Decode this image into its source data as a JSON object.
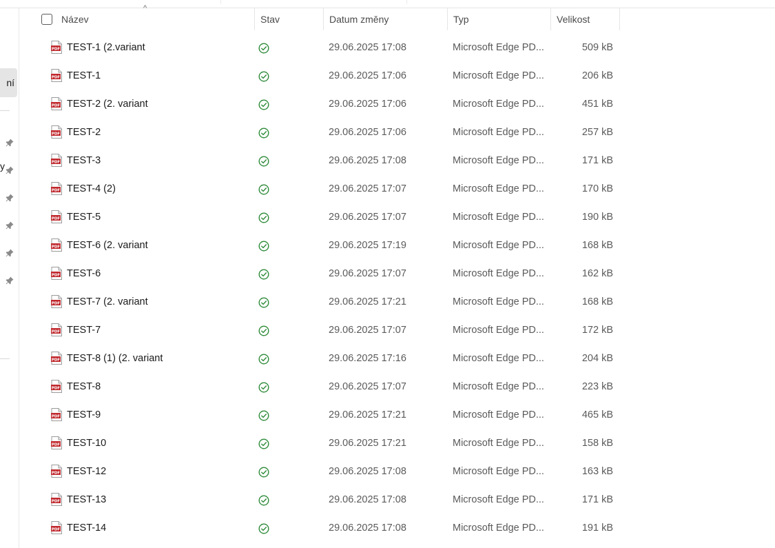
{
  "nav": {
    "active_label_fragment": "ní",
    "side_fragment": "y"
  },
  "columns": {
    "name": "Název",
    "status": "Stav",
    "date": "Datum změny",
    "type": "Typ",
    "size": "Velikost"
  },
  "files": [
    {
      "name": "TEST-1 (2.variant",
      "date": "29.06.2025 17:08",
      "type": "Microsoft Edge PD...",
      "size": "509 kB"
    },
    {
      "name": "TEST-1",
      "date": "29.06.2025 17:06",
      "type": "Microsoft Edge PD...",
      "size": "206 kB"
    },
    {
      "name": "TEST-2 (2. variant",
      "date": "29.06.2025 17:06",
      "type": "Microsoft Edge PD...",
      "size": "451 kB"
    },
    {
      "name": "TEST-2",
      "date": "29.06.2025 17:06",
      "type": "Microsoft Edge PD...",
      "size": "257 kB"
    },
    {
      "name": "TEST-3",
      "date": "29.06.2025 17:08",
      "type": "Microsoft Edge PD...",
      "size": "171 kB"
    },
    {
      "name": "TEST-4 (2)",
      "date": "29.06.2025 17:07",
      "type": "Microsoft Edge PD...",
      "size": "170 kB"
    },
    {
      "name": "TEST-5",
      "date": "29.06.2025 17:07",
      "type": "Microsoft Edge PD...",
      "size": "190 kB"
    },
    {
      "name": "TEST-6 (2. variant",
      "date": "29.06.2025 17:19",
      "type": "Microsoft Edge PD...",
      "size": "168 kB"
    },
    {
      "name": "TEST-6",
      "date": "29.06.2025 17:07",
      "type": "Microsoft Edge PD...",
      "size": "162 kB"
    },
    {
      "name": "TEST-7 (2. variant",
      "date": "29.06.2025 17:21",
      "type": "Microsoft Edge PD...",
      "size": "168 kB"
    },
    {
      "name": "TEST-7",
      "date": "29.06.2025 17:07",
      "type": "Microsoft Edge PD...",
      "size": "172 kB"
    },
    {
      "name": "TEST-8 (1) (2. variant",
      "date": "29.06.2025 17:16",
      "type": "Microsoft Edge PD...",
      "size": "204 kB"
    },
    {
      "name": "TEST-8",
      "date": "29.06.2025 17:07",
      "type": "Microsoft Edge PD...",
      "size": "223 kB"
    },
    {
      "name": "TEST-9",
      "date": "29.06.2025 17:21",
      "type": "Microsoft Edge PD...",
      "size": "465 kB"
    },
    {
      "name": "TEST-10",
      "date": "29.06.2025 17:21",
      "type": "Microsoft Edge PD...",
      "size": "158 kB"
    },
    {
      "name": "TEST-12",
      "date": "29.06.2025 17:08",
      "type": "Microsoft Edge PD...",
      "size": "163 kB"
    },
    {
      "name": "TEST-13",
      "date": "29.06.2025 17:08",
      "type": "Microsoft Edge PD...",
      "size": "171 kB"
    },
    {
      "name": "TEST-14",
      "date": "29.06.2025 17:08",
      "type": "Microsoft Edge PD...",
      "size": "191 kB"
    }
  ],
  "icons": {
    "file": "pdf-file-icon",
    "status": "available-checkmark-icon",
    "pin": "pin-icon",
    "sort": "sort-ascending-icon"
  },
  "colors": {
    "status_green": "#2e8b3a",
    "pdf_red": "#c0282d",
    "selection_gray": "#e5e5e5"
  }
}
